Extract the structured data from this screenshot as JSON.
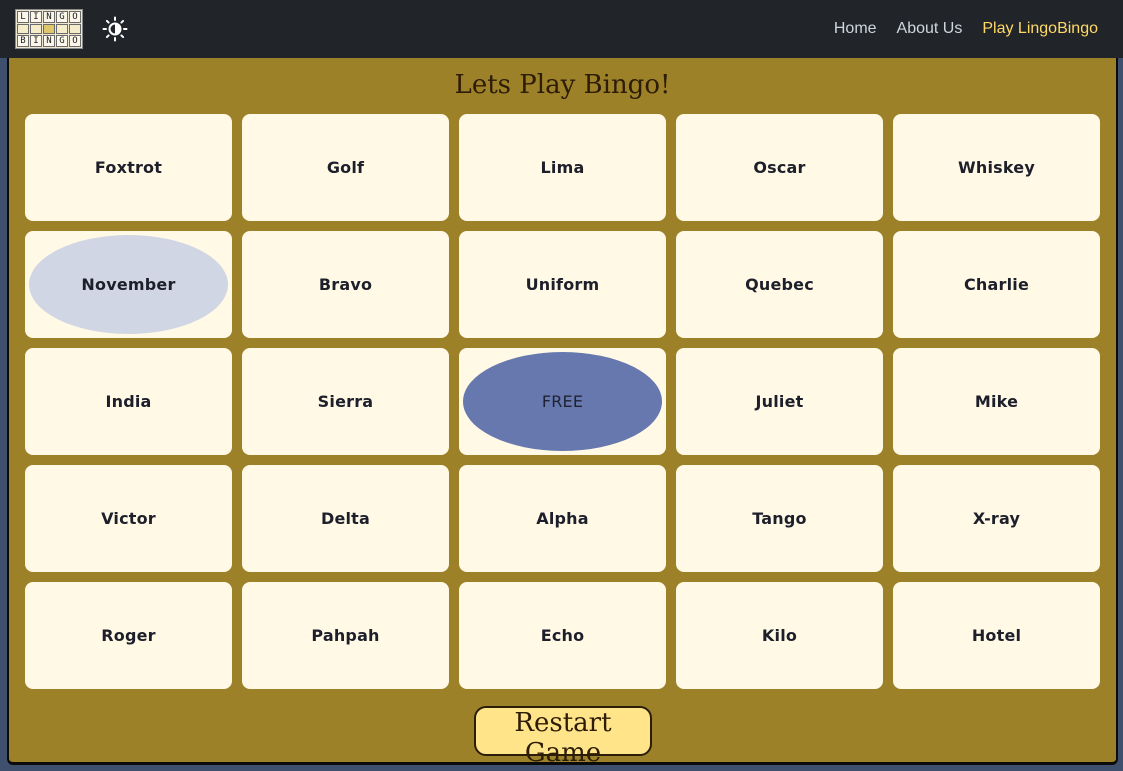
{
  "navbar": {
    "logo": {
      "rows": [
        [
          "L",
          "I",
          "N",
          "G",
          "O"
        ],
        [
          "",
          "",
          "",
          "",
          ""
        ],
        [
          "B",
          "I",
          "N",
          "G",
          "O"
        ]
      ]
    },
    "theme_toggle_icon": "brightness-icon",
    "links": [
      {
        "label": "Home"
      },
      {
        "label": "About Us"
      },
      {
        "label": "Play LingoBingo",
        "active": true
      }
    ],
    "active_color": "#ffd966"
  },
  "board": {
    "title": "Lets Play Bingo!",
    "background": "#9d8129",
    "tile_background": "#fff9e6",
    "tiles": [
      {
        "label": "Foxtrot",
        "marked": null
      },
      {
        "label": "Golf",
        "marked": null
      },
      {
        "label": "Lima",
        "marked": null
      },
      {
        "label": "Oscar",
        "marked": null
      },
      {
        "label": "Whiskey",
        "marked": null
      },
      {
        "label": "November",
        "marked": "#d1d6e4"
      },
      {
        "label": "Bravo",
        "marked": null
      },
      {
        "label": "Uniform",
        "marked": null
      },
      {
        "label": "Quebec",
        "marked": null
      },
      {
        "label": "Charlie",
        "marked": null
      },
      {
        "label": "India",
        "marked": null
      },
      {
        "label": "Sierra",
        "marked": null
      },
      {
        "label": "FREE",
        "marked": "#6678ae",
        "free": true
      },
      {
        "label": "Juliet",
        "marked": null
      },
      {
        "label": "Mike",
        "marked": null
      },
      {
        "label": "Victor",
        "marked": null
      },
      {
        "label": "Delta",
        "marked": null
      },
      {
        "label": "Alpha",
        "marked": null
      },
      {
        "label": "Tango",
        "marked": null
      },
      {
        "label": "X-ray",
        "marked": null
      },
      {
        "label": "Roger",
        "marked": null
      },
      {
        "label": "Pahpah",
        "marked": null
      },
      {
        "label": "Echo",
        "marked": null
      },
      {
        "label": "Kilo",
        "marked": null
      },
      {
        "label": "Hotel",
        "marked": null
      }
    ],
    "restart_label": "Restart Game"
  }
}
